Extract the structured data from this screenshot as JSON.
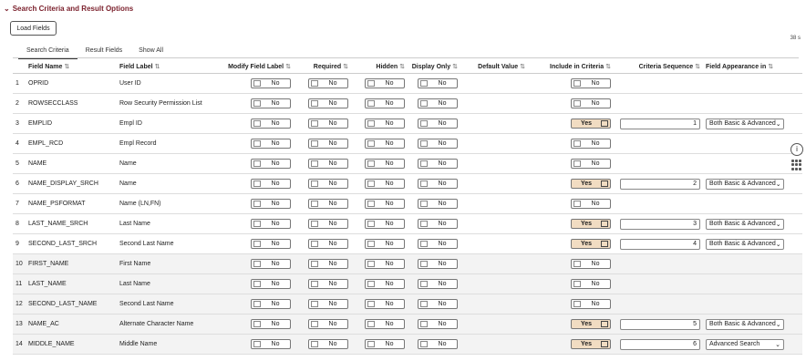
{
  "section": {
    "title": "Search Criteria and Result Options"
  },
  "load_button": "Load Fields",
  "tabs": [
    "Search Criteria",
    "Result Fields",
    "Show All"
  ],
  "row_count": "38 s",
  "columns": {
    "field_name": "Field Name",
    "field_label": "Field Label",
    "modify": "Modify Field Label",
    "required": "Required",
    "hidden": "Hidden",
    "display_only": "Display Only",
    "default": "Default Value",
    "include": "Include in Criteria",
    "sequence": "Criteria Sequence",
    "appearance": "Field Appearance in"
  },
  "sort_glyph": "⇅",
  "no": "No",
  "yes": "Yes",
  "rows": [
    {
      "n": "1",
      "name": "OPRID",
      "label": "User ID",
      "include": "No",
      "seq": "",
      "appearance": ""
    },
    {
      "n": "2",
      "name": "ROWSECCLASS",
      "label": "Row Security Permission List",
      "include": "No",
      "seq": "",
      "appearance": ""
    },
    {
      "n": "3",
      "name": "EMPLID",
      "label": "Empl ID",
      "include": "Yes",
      "seq": "1",
      "appearance": "Both Basic & Advanced"
    },
    {
      "n": "4",
      "name": "EMPL_RCD",
      "label": "Empl Record",
      "include": "No",
      "seq": "",
      "appearance": ""
    },
    {
      "n": "5",
      "name": "NAME",
      "label": "Name",
      "include": "No",
      "seq": "",
      "appearance": ""
    },
    {
      "n": "6",
      "name": "NAME_DISPLAY_SRCH",
      "label": "Name",
      "include": "Yes",
      "seq": "2",
      "appearance": "Both Basic & Advanced"
    },
    {
      "n": "7",
      "name": "NAME_PSFORMAT",
      "label": "Name (LN,FN)",
      "include": "No",
      "seq": "",
      "appearance": ""
    },
    {
      "n": "8",
      "name": "LAST_NAME_SRCH",
      "label": "Last Name",
      "include": "Yes",
      "seq": "3",
      "appearance": "Both Basic & Advanced"
    },
    {
      "n": "9",
      "name": "SECOND_LAST_SRCH",
      "label": "Second Last Name",
      "include": "Yes",
      "seq": "4",
      "appearance": "Both Basic & Advanced"
    },
    {
      "n": "10",
      "name": "FIRST_NAME",
      "label": "First Name",
      "include": "No",
      "seq": "",
      "appearance": ""
    },
    {
      "n": "11",
      "name": "LAST_NAME",
      "label": "Last Name",
      "include": "No",
      "seq": "",
      "appearance": ""
    },
    {
      "n": "12",
      "name": "SECOND_LAST_NAME",
      "label": "Second Last Name",
      "include": "No",
      "seq": "",
      "appearance": ""
    },
    {
      "n": "13",
      "name": "NAME_AC",
      "label": "Alternate Character Name",
      "include": "Yes",
      "seq": "5",
      "appearance": "Both Basic & Advanced"
    },
    {
      "n": "14",
      "name": "MIDDLE_NAME",
      "label": "Middle Name",
      "include": "Yes",
      "seq": "6",
      "appearance": "Advanced Search"
    }
  ]
}
